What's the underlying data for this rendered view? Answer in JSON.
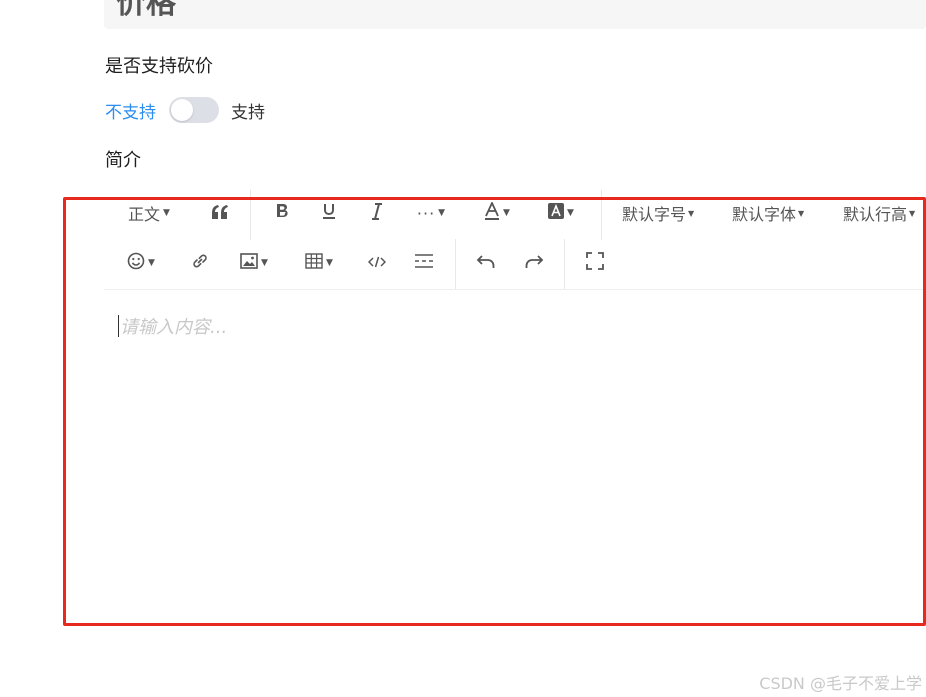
{
  "price_title": "价格",
  "bargain_label": "是否支持砍价",
  "switch": {
    "off_label": "不支持",
    "on_label": "支持",
    "checked": false
  },
  "intro_label": "简介",
  "toolbar": {
    "paragraph_label": "正文",
    "font_size_label": "默认字号",
    "font_family_label": "默认字体",
    "line_height_label": "默认行高"
  },
  "editor": {
    "placeholder": "请输入内容..."
  },
  "watermark": "CSDN @毛子不爱上学",
  "colors": {
    "highlight": "#e8291d",
    "switch_label_active": "#2d8cf0",
    "switch_track": "#dcdfe6"
  }
}
